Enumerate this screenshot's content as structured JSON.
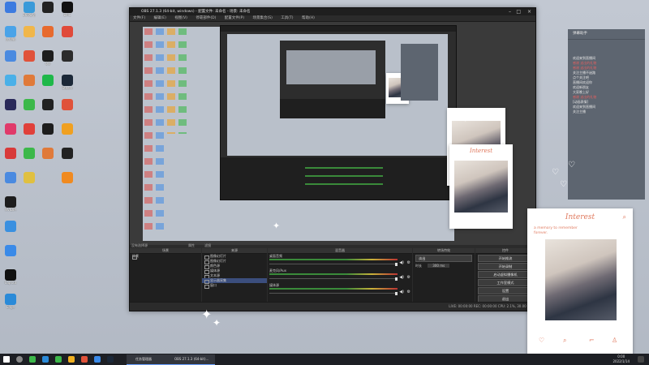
{
  "desktop": {
    "icons": [
      {
        "label": "",
        "color": "#3d7be0"
      },
      {
        "label": "360安全",
        "color": "#3a9ad9"
      },
      {
        "label": "",
        "color": "#222"
      },
      {
        "label": "EPIC",
        "color": "#111"
      },
      {
        "label": "此电脑",
        "color": "#4aa3e8"
      },
      {
        "label": "",
        "color": "#f0b64a"
      },
      {
        "label": "",
        "color": "#e76a2e"
      },
      {
        "label": "",
        "color": "#e04a3a"
      },
      {
        "label": "",
        "color": "#4a8ae0"
      },
      {
        "label": "",
        "color": "#e0523a"
      },
      {
        "label": "QQ",
        "color": "#1d1d1d"
      },
      {
        "label": "",
        "color": "#2b2b2b"
      },
      {
        "label": "",
        "color": "#4ab0e8"
      },
      {
        "label": "",
        "color": "#e07a3a"
      },
      {
        "label": "",
        "color": "#1fb84a"
      },
      {
        "label": "Steam",
        "color": "#1b2838"
      },
      {
        "label": "",
        "color": "#2a2a5a"
      },
      {
        "label": "",
        "color": "#3cb84a"
      },
      {
        "label": "",
        "color": "#222"
      },
      {
        "label": "",
        "color": "#e0523a"
      },
      {
        "label": "",
        "color": "#e03a6a"
      },
      {
        "label": "",
        "color": "#e0403a"
      },
      {
        "label": "",
        "color": "#1d1d1d"
      },
      {
        "label": "",
        "color": "#f0a020"
      },
      {
        "label": "",
        "color": "#d83a3a"
      },
      {
        "label": "",
        "color": "#3cb84a"
      },
      {
        "label": "",
        "color": "#e07a3a"
      },
      {
        "label": "",
        "color": "#222"
      },
      {
        "label": "",
        "color": "#4a8ae0"
      },
      {
        "label": "",
        "color": "#e0c040"
      },
      {
        "label": "NVIDIA",
        "color": "#1d1d1d"
      },
      {
        "label": "",
        "color": "#f08a20"
      },
      {
        "label": "",
        "color": "#3a90e0"
      },
      {
        "label": "",
        "color": "#3a8ae8"
      },
      {
        "label": "CapCut",
        "color": "#111"
      },
      {
        "label": "Edge",
        "color": "#2a8ad8"
      }
    ]
  },
  "obs": {
    "title": "OBS 27.1.3 (64-bit, windows) - 配置文件: 未命名 - 场景: 未命名",
    "menu": [
      "文件(F)",
      "编辑(E)",
      "视图(V)",
      "停靠部件(D)",
      "配置文件(P)",
      "场景集合(S)",
      "工具(T)",
      "帮助(H)"
    ],
    "docks": {
      "scenes": "场景",
      "sources": "来源",
      "mixer": "混音器",
      "transitions": "转场特效",
      "controls": "控件"
    },
    "no_source": "没有选择源",
    "properties": "属性",
    "filters": "滤镜",
    "scene_item": "场景",
    "sources_list": [
      "图像幻灯片",
      "图像幻灯片",
      "颜色源",
      "媒体源",
      "文本源",
      "显示器采集",
      "窗口"
    ],
    "mixer_rows": [
      {
        "label": "桌面音频",
        "db": "0.0 dB"
      },
      {
        "label": "麦克风/Aux",
        "db": "0.0 dB"
      },
      {
        "label": "媒体源",
        "db": "0.0 dB"
      }
    ],
    "transition": "淡出",
    "duration_label": "时长",
    "duration": "300 ms",
    "controls": [
      "开始推流",
      "开始录制",
      "启动虚拟摄像机",
      "工作室模式",
      "设置",
      "退出"
    ],
    "status": "LIVE: 00:00:00   REC: 00:00:00   CPU: 2.1%, 30.00 fps"
  },
  "chat": {
    "header": "弹幕助手",
    "messages": [
      {
        "text": "欢迎来到直播间",
        "red": false
      },
      {
        "text": "感谢 送出的礼物",
        "red": true
      },
      {
        "text": "感谢 送出的礼物",
        "red": true
      },
      {
        "text": "",
        "red": false
      },
      {
        "text": "关注主播不迷路",
        "red": false
      },
      {
        "text": "点个关注吧",
        "red": false
      },
      {
        "text": "直播间欢迎你",
        "red": false
      },
      {
        "text": "",
        "red": false
      },
      {
        "text": "欢迎新朋友",
        "red": false
      },
      {
        "text": "大家晚上好",
        "red": false
      },
      {
        "text": "",
        "red": false
      },
      {
        "text": "感谢 送出的礼物",
        "red": true
      },
      {
        "text": "[动画表情]",
        "red": false
      },
      {
        "text": "",
        "red": false
      },
      {
        "text": "",
        "red": false
      },
      {
        "text": "欢迎来到直播间",
        "red": false
      },
      {
        "text": "关注主播",
        "red": false
      }
    ]
  },
  "card_large": {
    "title": "Interest",
    "caption_lines": [
      "a memory to remember",
      "forever."
    ]
  },
  "card_small": {
    "title": "Interest"
  },
  "taskbar": {
    "apps": [
      "任务管理器",
      "OBS 27.1.3 (64-bit)..."
    ],
    "time": "0:00",
    "date": "2022/1/14"
  }
}
